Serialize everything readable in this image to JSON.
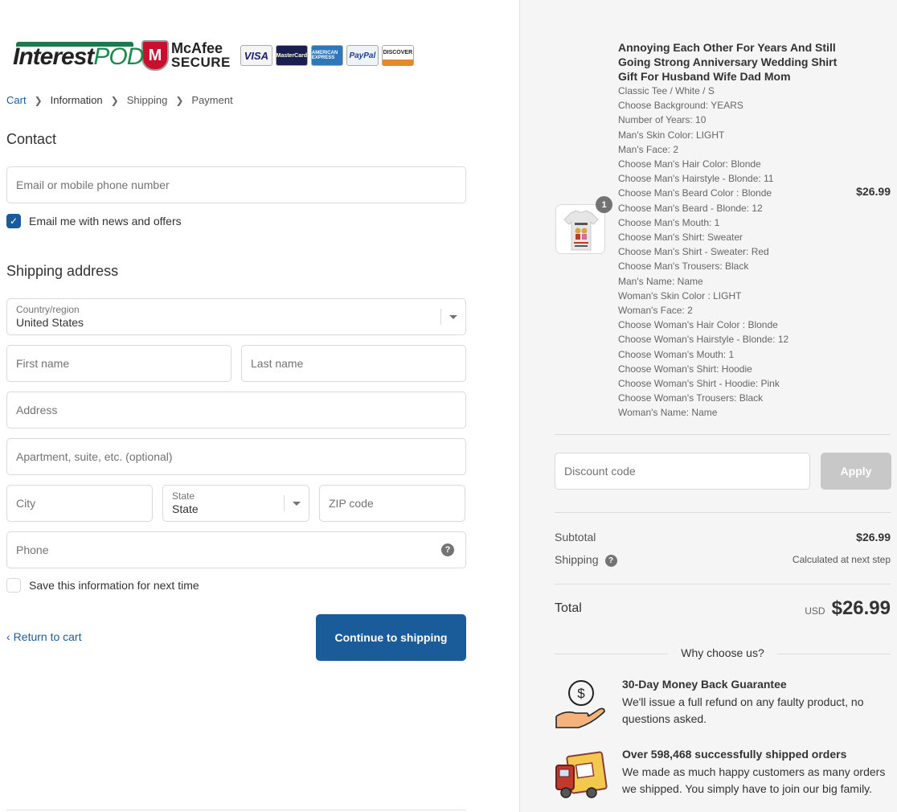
{
  "brand": {
    "name_part1": "Interest",
    "name_part2": "POD"
  },
  "trust": {
    "mcafee_line1": "McAfee",
    "mcafee_line2": "SECURE",
    "shield_letter": "M"
  },
  "payment_cards": [
    "VISA",
    "MasterCard",
    "AMERICAN EXPRESS",
    "PayPal",
    "DISCOVER"
  ],
  "breadcrumb": {
    "items": [
      "Cart",
      "Information",
      "Shipping",
      "Payment"
    ],
    "separator": ">"
  },
  "contact": {
    "heading": "Contact",
    "email_placeholder": "Email or mobile phone number",
    "newsletter_label": "Email me with news and offers",
    "newsletter_checked": true
  },
  "shipping": {
    "heading": "Shipping address",
    "country_label": "Country/region",
    "country_value": "United States",
    "first_name_placeholder": "First name",
    "last_name_placeholder": "Last name",
    "address_placeholder": "Address",
    "apartment_placeholder": "Apartment, suite, etc. (optional)",
    "city_placeholder": "City",
    "state_label": "State",
    "state_value": "State",
    "zip_placeholder": "ZIP code",
    "phone_placeholder": "Phone",
    "save_label": "Save this information for next time",
    "save_checked": false
  },
  "actions": {
    "return_label": "Return to cart",
    "continue_label": "Continue to shipping"
  },
  "order": {
    "product_title": "Annoying Each Other For Years And Still Going Strong Anniversary Wedding Shirt Gift For Husband Wife Dad Mom",
    "quantity": "1",
    "price": "$26.99",
    "options": [
      "Classic Tee / White / S",
      "Choose Background: YEARS",
      "Number of Years: 10",
      "Man's Skin Color: LIGHT",
      "Man's Face: 2",
      "Choose Man's Hair Color: Blonde",
      "Choose Man's Hairstyle - Blonde: 11",
      "Choose Man's Beard Color : Blonde",
      "Choose Man's Beard - Blonde: 12",
      "Choose Man's Mouth: 1",
      "Choose Man's Shirt: Sweater",
      "Choose Man's Shirt - Sweater: Red",
      "Choose Man's Trousers: Black",
      "Man's Name: Name",
      "Woman's Skin Color : LIGHT",
      "Woman's Face: 2",
      "Choose Woman's Hair Color : Blonde",
      "Choose Woman's Hairstyle - Blonde: 12",
      "Choose Woman's Mouth: 1",
      "Choose Woman's Shirt: Hoodie",
      "Choose Woman's Shirt - Hoodie: Pink",
      "Choose Woman's Trousers: Black",
      "Woman's Name: Name"
    ],
    "discount_placeholder": "Discount code",
    "apply_label": "Apply",
    "subtotal_label": "Subtotal",
    "subtotal_value": "$26.99",
    "shipping_label": "Shipping",
    "shipping_value": "Calculated at next step",
    "total_label": "Total",
    "currency": "USD",
    "total_value": "$26.99"
  },
  "why": {
    "heading": "Why choose us?",
    "features": [
      {
        "icon": "money-back-hand-icon",
        "title": "30-Day Money Back Guarantee",
        "desc": "We'll issue a full refund on any faulty product, no questions asked."
      },
      {
        "icon": "delivery-truck-icon",
        "title": "Over 598,468 successfully shipped orders",
        "desc": "We made as much happy customers as many orders we shipped. You simply have to join our big family."
      }
    ]
  },
  "colors": {
    "accent": "#1a5b9a",
    "sidebar_bg": "#f5f5f5",
    "brand_green": "#1a8a4d"
  }
}
